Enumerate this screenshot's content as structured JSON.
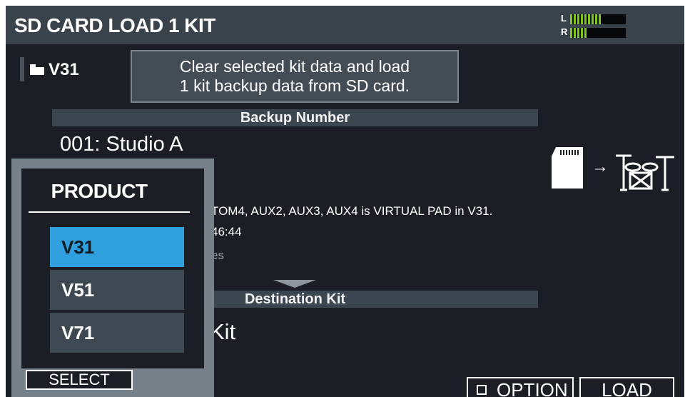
{
  "title": "SD CARD LOAD 1 KIT",
  "meter": {
    "l_label": "L",
    "r_label": "R",
    "l_level": 0.55,
    "r_level": 0.32,
    "color": "#7dc81e"
  },
  "folder": {
    "icon": "folder-icon",
    "name": "V31"
  },
  "message": {
    "line1": "Clear selected kit data and load",
    "line2": "1 kit backup data from SD card."
  },
  "backup": {
    "header": "Backup Number",
    "value": "001: Studio A"
  },
  "info": {
    "line1": "TOM4, AUX2, AUX3, AUX4 is VIRTUAL PAD in V31.",
    "line2": "46:44",
    "line3": "es"
  },
  "destination": {
    "header": "Destination Kit",
    "value": "Kit"
  },
  "product_popup": {
    "title": "PRODUCT",
    "items": [
      {
        "label": "V31",
        "selected": true
      },
      {
        "label": "V51",
        "selected": false
      },
      {
        "label": "V71",
        "selected": false
      }
    ],
    "select_label": "SELECT",
    "selected_color": "#2f9fdd"
  },
  "buttons": {
    "option_label": "OPTION",
    "load_label": "LOAD"
  },
  "icons": {
    "sd_card": "sd-card-icon",
    "arrow": "arrow-right-icon",
    "drum_kit": "drum-kit-icon"
  }
}
